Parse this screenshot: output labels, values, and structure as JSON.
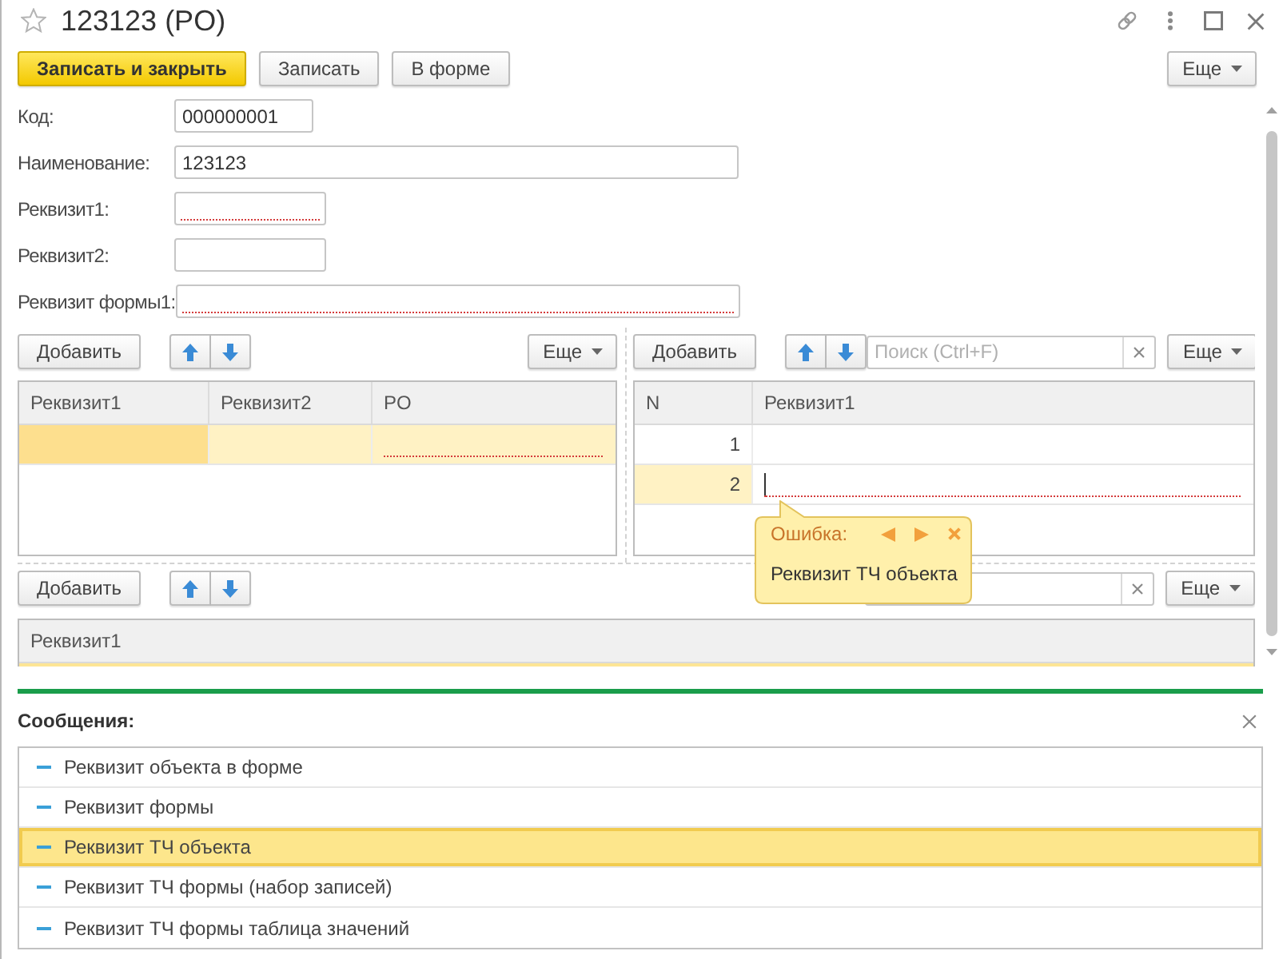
{
  "window": {
    "title": "123123 (PO)"
  },
  "command_bar": {
    "buttons": [
      {
        "label": "Записать и закрыть",
        "kind": "default"
      },
      {
        "label": "Записать",
        "kind": "regular"
      },
      {
        "label": "В форме",
        "kind": "regular"
      }
    ],
    "more": "Еще"
  },
  "fields": [
    {
      "label": "Код:",
      "value": "000000001",
      "invalid": false
    },
    {
      "label": "Наименование:",
      "value": "123123",
      "invalid": false
    },
    {
      "label": "Реквизит1:",
      "invalid": true
    },
    {
      "label": "Реквизит2:",
      "invalid": false
    },
    {
      "label": "Реквизит формы1:",
      "invalid": true
    }
  ],
  "tables": [
    {
      "toolbar": {
        "add": "Добавить",
        "more": "Еще"
      },
      "columns": [
        {
          "title": "Реквизит1",
          "kind": "text"
        },
        {
          "title": "Реквизит2",
          "kind": "text"
        },
        {
          "title": "PO",
          "kind": "text"
        }
      ],
      "rows": [
        {
          "selected": true,
          "cells": [
            {
              "current": true,
              "editing": false,
              "invalid": false
            },
            {
              "current": false,
              "editing": false,
              "invalid": false
            },
            {
              "current": false,
              "editing": false,
              "invalid": true
            }
          ]
        }
      ]
    },
    {
      "toolbar": {
        "add": "Добавить",
        "search": {
          "placeholder": "Поиск (Ctrl+F)",
          "clear": true
        },
        "more": "Еще"
      },
      "columns": [
        {
          "title": "N",
          "kind": "number"
        },
        {
          "title": "Реквизит1",
          "kind": "text"
        }
      ],
      "rows": [
        {
          "selected": false,
          "cells": [
            {
              "text": "1",
              "current": false,
              "editing": false,
              "invalid": false
            },
            {
              "current": false,
              "editing": false,
              "invalid": false
            }
          ]
        },
        {
          "selected": true,
          "cells": [
            {
              "text": "2",
              "current": false,
              "editing": false,
              "invalid": false
            },
            {
              "current": false,
              "editing": true,
              "invalid": true
            }
          ]
        }
      ]
    },
    {
      "toolbar": {
        "add": "Добавить",
        "search": {
          "clear": true
        },
        "more": "Еще"
      },
      "columns": [
        {
          "title": "Реквизит1",
          "kind": "text"
        }
      ],
      "rows": [
        {
          "selected": true
        }
      ]
    }
  ],
  "error_tooltip": {
    "title": "Ошибка:",
    "text": "Реквизит ТЧ объекта"
  },
  "messages": {
    "title": "Сообщения:",
    "items": [
      {
        "text": "Реквизит объекта в форме",
        "selected": false
      },
      {
        "text": "Реквизит формы",
        "selected": false
      },
      {
        "text": "Реквизит ТЧ объекта",
        "selected": true
      },
      {
        "text": "Реквизит ТЧ формы (набор записей)",
        "selected": false
      },
      {
        "text": "Реквизит ТЧ формы таблица значений",
        "selected": false
      }
    ]
  }
}
